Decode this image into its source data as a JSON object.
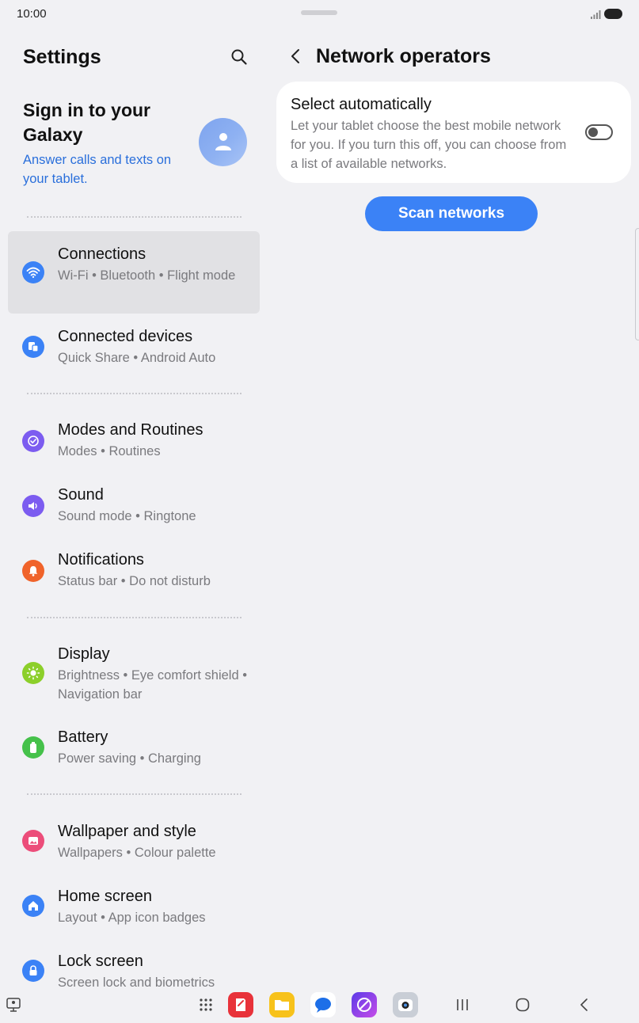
{
  "status_bar": {
    "time": "10:00"
  },
  "left_panel": {
    "title": "Settings",
    "account": {
      "title": "Sign in to your Galaxy",
      "subtitle": "Answer calls and texts on your tablet."
    },
    "items": [
      {
        "title": "Connections",
        "subtitle": "Wi-Fi  •  Bluetooth  •  Flight mode",
        "color": "#3b82f6",
        "icon": "wifi-icon"
      },
      {
        "title": "Connected devices",
        "subtitle": "Quick Share  •  Android Auto",
        "color": "#3b82f6",
        "icon": "connected-devices-icon"
      },
      {
        "title": "Modes and Routines",
        "subtitle": "Modes  •  Routines",
        "color": "#7c5cf0",
        "icon": "modes-routines-icon"
      },
      {
        "title": "Sound",
        "subtitle": "Sound mode  •  Ringtone",
        "color": "#7c5cf0",
        "icon": "speaker-icon"
      },
      {
        "title": "Notifications",
        "subtitle": "Status bar  •  Do not disturb",
        "color": "#f0632a",
        "icon": "bell-icon"
      },
      {
        "title": "Display",
        "subtitle": "Brightness  •  Eye comfort shield  •  Navigation bar",
        "color": "#8ccf2a",
        "icon": "sun-icon"
      },
      {
        "title": "Battery",
        "subtitle": "Power saving  •  Charging",
        "color": "#45c14a",
        "icon": "battery-icon"
      },
      {
        "title": "Wallpaper and style",
        "subtitle": "Wallpapers  •  Colour palette",
        "color": "#ec4d7a",
        "icon": "image-icon"
      },
      {
        "title": "Home screen",
        "subtitle": "Layout  •  App icon badges",
        "color": "#3b82f6",
        "icon": "home-icon"
      },
      {
        "title": "Lock screen",
        "subtitle": "Screen lock and biometrics",
        "color": "#3b82f6",
        "icon": "lock-icon"
      }
    ]
  },
  "right_panel": {
    "title": "Network operators",
    "auto_select": {
      "title": "Select automatically",
      "description": "Let your tablet choose the best mobile network for you. If you turn this off, you can choose from a list of available networks.",
      "enabled": false
    },
    "scan_button": "Scan networks"
  },
  "colors": {
    "accent": "#3b82f6",
    "link": "#2a6fdb"
  },
  "nav_bar": {
    "apps": [
      "notes-app-icon",
      "files-app-icon",
      "messages-app-icon",
      "internet-app-icon",
      "camera-app-icon"
    ]
  }
}
